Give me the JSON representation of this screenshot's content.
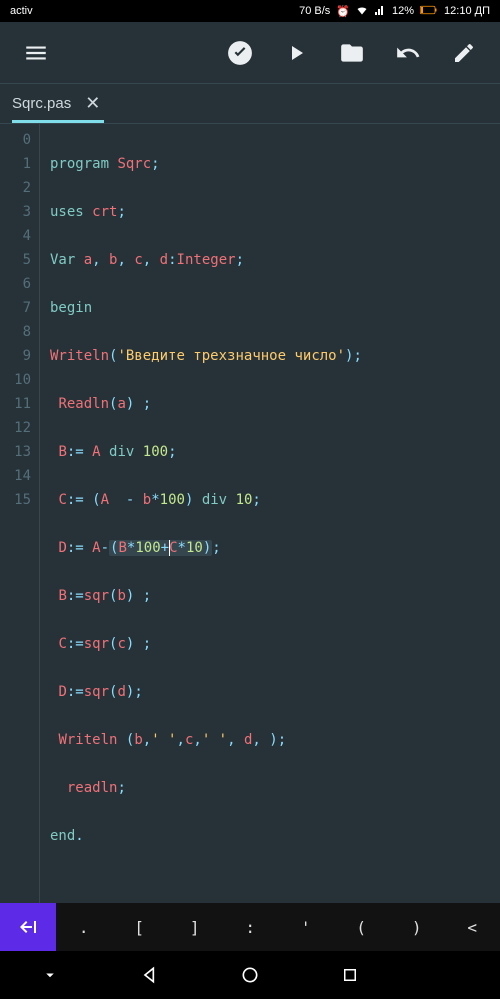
{
  "status": {
    "carrier": "activ",
    "speed": "70 B/s",
    "battery": "12%",
    "time": "12:10 ДП"
  },
  "tab": {
    "name": "Sqrc.pas"
  },
  "code_lines": [
    "program Sqrc;",
    "uses crt;",
    "Var a, b, c, d:Integer;",
    "begin",
    "Writeln('Введите трехзначное число');",
    " Readln(a) ;",
    " B:= A div 100;",
    " C:= (A  - b*100) div 10;",
    " D:= A-(B*100+C*10);",
    " B:=sqr(b) ;",
    " C:=sqr(c) ;",
    " D:=sqr(d);",
    " Writeln (b,' ',c,' ', d, );",
    "  readln;",
    "end.",
    ""
  ],
  "symbol_keys": [
    ".",
    "[",
    "]",
    ":",
    "'",
    "(",
    ")",
    "<"
  ],
  "line_numbers": [
    "0",
    "1",
    "2",
    "3",
    "4",
    "5",
    "6",
    "7",
    "8",
    "9",
    "10",
    "11",
    "12",
    "13",
    "14",
    "15"
  ]
}
